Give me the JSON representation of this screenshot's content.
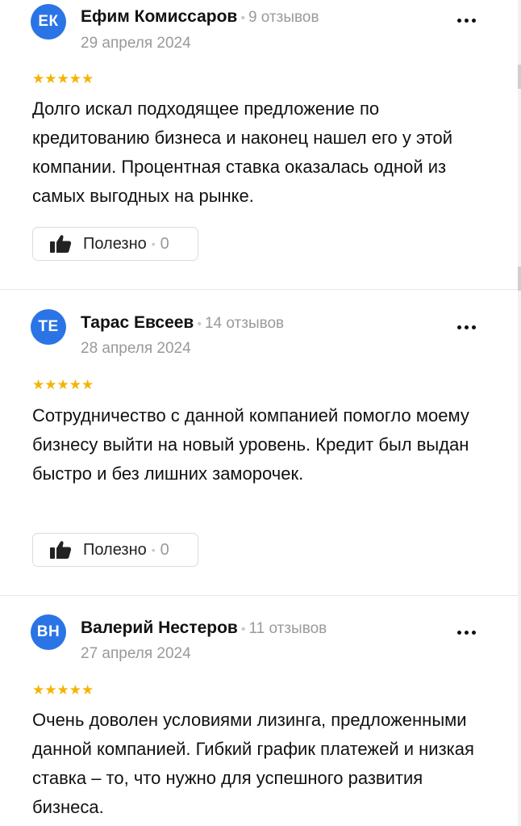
{
  "reviews": [
    {
      "initials": "ЕК",
      "author": "Ефим Комиссаров",
      "reviews_count": "9 отзывов",
      "date": "29 апреля 2024",
      "stars": "★★★★★",
      "rating": 5,
      "text": "Долго искал подходящее предложение по кредитованию бизнеса и наконец нашел его у этой компании. Процентная ставка оказалась одной из самых выгодных на рынке.",
      "helpful_label": "Полезно",
      "helpful_count": "0"
    },
    {
      "initials": "ТЕ",
      "author": "Тарас Евсеев",
      "reviews_count": "14 отзывов",
      "date": "28 апреля 2024",
      "stars": "★★★★★",
      "rating": 5,
      "text": "Сотрудничество с данной компанией помогло моему бизнесу выйти на новый уровень. Кредит был выдан быстро и без лишних заморочек.",
      "helpful_label": "Полезно",
      "helpful_count": "0"
    },
    {
      "initials": "ВН",
      "author": "Валерий Нестеров",
      "reviews_count": "11 отзывов",
      "date": "27 апреля 2024",
      "stars": "★★★★★",
      "rating": 5,
      "text": "Очень доволен условиями лизинга, предложенными данной компанией. Гибкий график платежей и низкая ставка – то, что нужно для успешного развития бизнеса."
    }
  ],
  "separator": "•",
  "colors": {
    "avatar": "#2a74e6",
    "star": "#f4b400",
    "muted": "#999999"
  },
  "icons": {
    "like": "thumbs-up-icon",
    "menu": "more-options-icon"
  }
}
